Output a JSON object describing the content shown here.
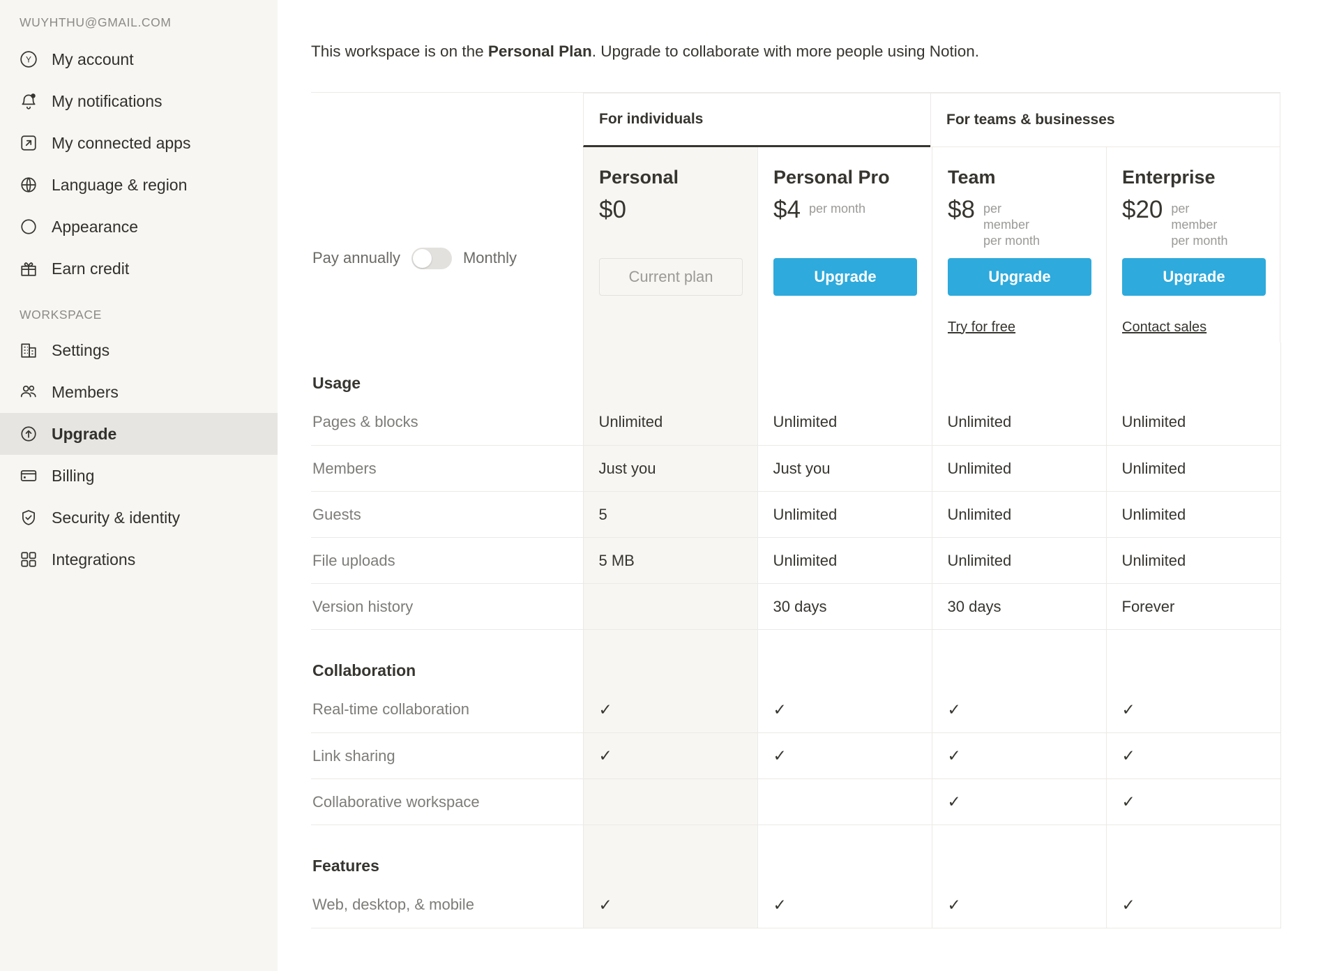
{
  "sidebar": {
    "account_email": "WUYHTHU@GMAIL.COM",
    "workspace_label": "WORKSPACE",
    "account_items": [
      {
        "label": "My account",
        "icon": "avatar-y-icon"
      },
      {
        "label": "My notifications",
        "icon": "bell-icon"
      },
      {
        "label": "My connected apps",
        "icon": "external-link-icon"
      },
      {
        "label": "Language & region",
        "icon": "globe-icon"
      },
      {
        "label": "Appearance",
        "icon": "moon-icon"
      },
      {
        "label": "Earn credit",
        "icon": "gift-icon"
      }
    ],
    "workspace_items": [
      {
        "label": "Settings",
        "icon": "building-icon",
        "active": false
      },
      {
        "label": "Members",
        "icon": "people-icon",
        "active": false
      },
      {
        "label": "Upgrade",
        "icon": "arrow-up-circle-icon",
        "active": true
      },
      {
        "label": "Billing",
        "icon": "credit-card-icon",
        "active": false
      },
      {
        "label": "Security & identity",
        "icon": "shield-check-icon",
        "active": false
      },
      {
        "label": "Integrations",
        "icon": "grid-icon",
        "active": false
      }
    ]
  },
  "banner": {
    "prefix": "This workspace is on the ",
    "plan": "Personal Plan",
    "suffix": ". Upgrade to collaborate with more people using Notion."
  },
  "billing_toggle": {
    "left_label": "Pay annually",
    "right_label": "Monthly",
    "state": "monthly"
  },
  "audiences": [
    {
      "label": "For individuals",
      "selected": true
    },
    {
      "label": "For teams & businesses",
      "selected": false
    }
  ],
  "plans": [
    {
      "name": "Personal",
      "price": "$0",
      "per": "",
      "cta": "Current plan",
      "cta_type": "current",
      "sub_link": "",
      "shaded": true
    },
    {
      "name": "Personal Pro",
      "price": "$4",
      "per": "per month",
      "cta": "Upgrade",
      "cta_type": "primary",
      "sub_link": "",
      "shaded": false
    },
    {
      "name": "Team",
      "price": "$8",
      "per": "per\nmember\nper month",
      "cta": "Upgrade",
      "cta_type": "primary",
      "sub_link": "Try for free",
      "shaded": false
    },
    {
      "name": "Enterprise",
      "price": "$20",
      "per": "per\nmember\nper month",
      "cta": "Upgrade",
      "cta_type": "primary",
      "sub_link": "Contact sales",
      "shaded": false
    }
  ],
  "colors": {
    "accent": "#2eaadc",
    "sidebar_bg": "#f7f6f3",
    "active_bg": "#e7e5e1",
    "text": "#37352f",
    "muted": "#9b9a97",
    "border": "#eceae6"
  },
  "feature_table": {
    "groups": [
      {
        "title": "Usage",
        "rows": [
          {
            "label": "Pages & blocks",
            "values": [
              "Unlimited",
              "Unlimited",
              "Unlimited",
              "Unlimited"
            ]
          },
          {
            "label": "Members",
            "values": [
              "Just you",
              "Just you",
              "Unlimited",
              "Unlimited"
            ]
          },
          {
            "label": "Guests",
            "values": [
              "5",
              "Unlimited",
              "Unlimited",
              "Unlimited"
            ]
          },
          {
            "label": "File uploads",
            "values": [
              "5 MB",
              "Unlimited",
              "Unlimited",
              "Unlimited"
            ]
          },
          {
            "label": "Version history",
            "values": [
              "",
              "30 days",
              "30 days",
              "Forever"
            ]
          }
        ]
      },
      {
        "title": "Collaboration",
        "rows": [
          {
            "label": "Real-time collaboration",
            "values": [
              "✓",
              "✓",
              "✓",
              "✓"
            ]
          },
          {
            "label": "Link sharing",
            "values": [
              "✓",
              "✓",
              "✓",
              "✓"
            ]
          },
          {
            "label": "Collaborative workspace",
            "values": [
              "",
              "",
              "✓",
              "✓"
            ]
          }
        ]
      },
      {
        "title": "Features",
        "rows": [
          {
            "label": "Web, desktop, & mobile",
            "values": [
              "✓",
              "✓",
              "✓",
              "✓"
            ]
          }
        ]
      }
    ]
  }
}
